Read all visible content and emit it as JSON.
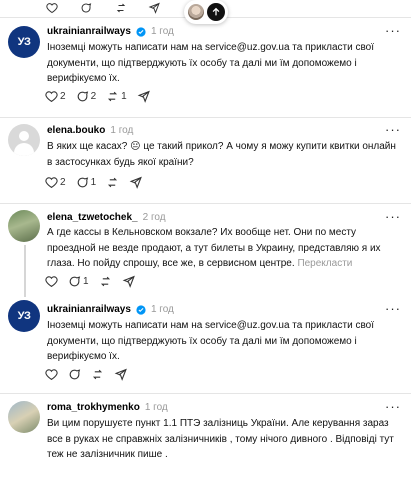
{
  "top_actions": {
    "likes": "",
    "replies": "",
    "reposts": ""
  },
  "posts": [
    {
      "username": "ukrainianrailways",
      "verified": true,
      "time": "1 год",
      "avatar_text": "УЗ",
      "text": "Іноземці можуть написати нам на service@uz.gov.ua та прикласти свої документи, що підтверджують їх особу та далі ми їм допоможемо і верифікуємо їх.",
      "likes": "2",
      "replies": "2",
      "reposts": "1"
    },
    {
      "username": "elena.bouko",
      "verified": false,
      "time": "1 год",
      "text_before": "В яких ще касах? ",
      "emoji": "😐",
      "text_after": " це такий прикол? А чому я можу купити квитки онлайн в застосунках будь якої країни?",
      "likes": "2",
      "replies": "1",
      "reposts": ""
    },
    {
      "username": "elena_tzwetochek_",
      "verified": false,
      "time": "2 год",
      "text": "А где кассы в Кельновском вокзале? Их вообще нет. Они по месту проездной не везде продают, а тут билеты в Украину, представляю я их глаза. Но пойду спрошу, все же, в сервисном центре.",
      "translate": "Перекласти",
      "likes": "",
      "replies": "1",
      "reposts": ""
    },
    {
      "username": "ukrainianrailways",
      "verified": true,
      "time": "1 год",
      "avatar_text": "УЗ",
      "text": "Іноземці можуть написати нам на service@uz.gov.ua та прикласти свої документи, що підтверджують їх особу та далі ми їм допоможемо і верифікуємо їх.",
      "likes": "",
      "replies": "",
      "reposts": ""
    },
    {
      "username": "roma_trokhymenko",
      "verified": false,
      "time": "1 год",
      "text": "Ви цим порушуєте пункт 1.1 ПТЭ залізниць України. Але керування зараз все в руках не справжніх залізничників , тому нічого дивного . Відповіді тут теж не залізничник пише ."
    }
  ],
  "more_label": "···"
}
